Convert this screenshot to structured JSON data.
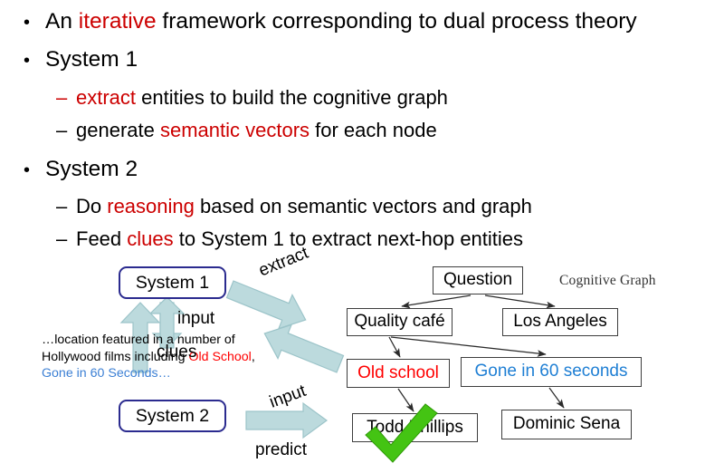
{
  "slide": {
    "bullets": [
      {
        "level": 1,
        "marker": "•",
        "parts": [
          {
            "text": "An ",
            "color": "black"
          },
          {
            "text": "iterative",
            "color": "red"
          },
          {
            "text": " framework corresponding to dual process theory",
            "color": "black"
          }
        ]
      },
      {
        "level": 1,
        "marker": "•",
        "parts": [
          {
            "text": "System 1",
            "color": "black"
          }
        ]
      },
      {
        "level": 2,
        "marker": "–",
        "marker_color": "red",
        "parts": [
          {
            "text": "extract",
            "color": "red"
          },
          {
            "text": " entities to build the cognitive graph",
            "color": "black"
          }
        ]
      },
      {
        "level": 2,
        "marker": "–",
        "marker_color": "black",
        "parts": [
          {
            "text": "generate ",
            "color": "black"
          },
          {
            "text": "semantic vectors",
            "color": "red"
          },
          {
            "text": " for each node",
            "color": "black"
          }
        ]
      },
      {
        "level": 1,
        "marker": "•",
        "parts": [
          {
            "text": "System 2",
            "color": "black"
          }
        ]
      },
      {
        "level": 2,
        "marker": "–",
        "marker_color": "black",
        "parts": [
          {
            "text": "Do ",
            "color": "black"
          },
          {
            "text": "reasoning",
            "color": "red"
          },
          {
            "text": " based on semantic vectors and graph",
            "color": "black"
          }
        ]
      },
      {
        "level": 2,
        "marker": "–",
        "marker_color": "black",
        "parts": [
          {
            "text": "Feed ",
            "color": "black"
          },
          {
            "text": "clues",
            "color": "red"
          },
          {
            "text": " to System 1 to extract next-hop entities",
            "color": "black"
          }
        ]
      }
    ]
  },
  "diagram": {
    "systems": [
      {
        "id": "system-1",
        "label": "System 1"
      },
      {
        "id": "system-2",
        "label": "System 2"
      }
    ],
    "arrow_captions": {
      "extract": "extract",
      "input_top": "input",
      "clues": "clues",
      "input_bottom": "input",
      "predict": "predict"
    },
    "snippet": {
      "segment_1": "…location featured in a number of Hollywood films including ",
      "highlight_red": "Old School",
      "segment_2": ", ",
      "highlight_blue": "Gone in 60 Seconds…"
    },
    "graph": {
      "caption": "Cognitive Graph",
      "nodes": [
        {
          "id": "question",
          "label": "Question",
          "text_color": "#000000"
        },
        {
          "id": "quality-cafe",
          "label": "Quality café",
          "text_color": "#000000"
        },
        {
          "id": "los-angeles",
          "label": "Los Angeles",
          "text_color": "#000000"
        },
        {
          "id": "old-school",
          "label": "Old school",
          "text_color": "#FF0000"
        },
        {
          "id": "gone-60",
          "label": "Gone in 60 seconds",
          "text_color": "#1F7FD4"
        },
        {
          "id": "todd",
          "label": "Todd Phillips",
          "text_color": "#000000"
        },
        {
          "id": "dominic",
          "label": "Dominic Sena",
          "text_color": "#000000"
        }
      ],
      "edges": [
        {
          "from": "question",
          "to": "quality-cafe"
        },
        {
          "from": "question",
          "to": "los-angeles"
        },
        {
          "from": "quality-cafe",
          "to": "old-school"
        },
        {
          "from": "quality-cafe",
          "to": "gone-60"
        },
        {
          "from": "old-school",
          "to": "todd"
        },
        {
          "from": "gone-60",
          "to": "dominic"
        }
      ],
      "answer_marker": "check-mark",
      "answer_node": "todd"
    },
    "colors": {
      "accent_red": "#CC0000",
      "node_red": "#FF0000",
      "node_blue": "#1F7FD4",
      "system_border": "#2B2B8F",
      "block_arrow_fill": "#BCDADD",
      "block_arrow_stroke": "#8FBFC4",
      "check_green": "#44C413"
    }
  }
}
